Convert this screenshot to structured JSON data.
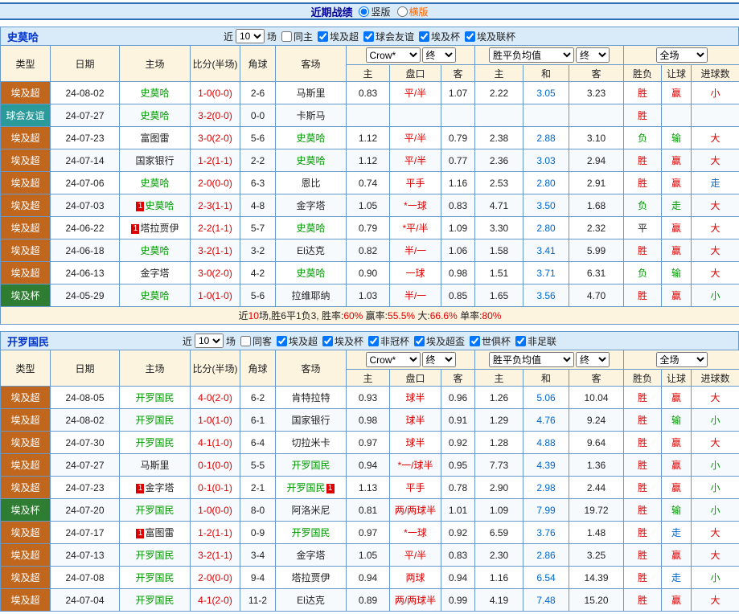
{
  "top_bar": {
    "title": "近期战绩",
    "radio_vertical": "竖版",
    "radio_horizontal": "横版",
    "vertical_selected": true
  },
  "colors": {
    "red": "#dd0000",
    "green": "#009900",
    "blue": "#0066cc",
    "black": "#222222",
    "team_green": "#009900",
    "type_league": "#c1671d",
    "type_friendly": "#2b9a9a",
    "type_cup": "#2e7d32",
    "bar_blue": "#d9eaf8",
    "header_cream": "#fdf4e0",
    "border_blue": "#6699cc",
    "title_blue": "#0000a0",
    "team_title_blue": "#0033cc",
    "orange_radio": "#ff6600"
  },
  "headers": {
    "type": "类型",
    "date": "日期",
    "home": "主场",
    "score": "比分(半场)",
    "corner": "角球",
    "away": "客场",
    "asian": [
      "主",
      "盘口",
      "客"
    ],
    "europe": [
      "主",
      "和",
      "客"
    ],
    "result": [
      "胜负",
      "让球",
      "进球数"
    ]
  },
  "selects": {
    "company": "Crow*",
    "company_time": "终",
    "europe": "胜平负均值",
    "europe_time": "终",
    "scope": "全场"
  },
  "sections": [
    {
      "team": "史莫哈",
      "filters": {
        "near": "近",
        "count": "10",
        "matches": "场",
        "checkboxes": [
          {
            "label": "同主",
            "checked": false
          },
          {
            "label": "埃及超",
            "checked": true
          },
          {
            "label": "球会友谊",
            "checked": true
          },
          {
            "label": "埃及杯",
            "checked": true
          },
          {
            "label": "埃及联杯",
            "checked": true
          }
        ]
      },
      "rows": [
        {
          "type": {
            "text": "埃及超",
            "kind": "league"
          },
          "date": "24-08-02",
          "home": {
            "name": "史莫哈",
            "green": true
          },
          "score": "1-0(0-0)",
          "corner": "2-6",
          "away": {
            "name": "马斯里"
          },
          "odds": [
            "0.83",
            "平/半",
            "1.07",
            "2.22",
            "3.05",
            "3.23"
          ],
          "results": [
            [
              "胜",
              "r"
            ],
            [
              "赢",
              "r"
            ],
            [
              "小",
              "r"
            ]
          ]
        },
        {
          "type": {
            "text": "球会友谊",
            "kind": "friendly"
          },
          "date": "24-07-27",
          "home": {
            "name": "史莫哈",
            "green": true
          },
          "score": "3-2(0-0)",
          "corner": "0-0",
          "away": {
            "name": "卡斯马"
          },
          "odds": [
            "",
            "",
            "",
            "",
            "",
            ""
          ],
          "results": [
            [
              "胜",
              "r"
            ],
            [
              "",
              ""
            ],
            [
              "",
              ""
            ]
          ]
        },
        {
          "type": {
            "text": "埃及超",
            "kind": "league"
          },
          "date": "24-07-23",
          "home": {
            "name": "富图雷"
          },
          "score": "3-0(2-0)",
          "corner": "5-6",
          "away": {
            "name": "史莫哈",
            "green": true
          },
          "odds": [
            "1.12",
            "平/半",
            "0.79",
            "2.38",
            "2.88",
            "3.10"
          ],
          "results": [
            [
              "负",
              "g"
            ],
            [
              "输",
              "g"
            ],
            [
              "大",
              "r"
            ]
          ]
        },
        {
          "type": {
            "text": "埃及超",
            "kind": "league"
          },
          "date": "24-07-14",
          "home": {
            "name": "国家银行"
          },
          "score": "1-2(1-1)",
          "corner": "2-2",
          "away": {
            "name": "史莫哈",
            "green": true
          },
          "odds": [
            "1.12",
            "平/半",
            "0.77",
            "2.36",
            "3.03",
            "2.94"
          ],
          "results": [
            [
              "胜",
              "r"
            ],
            [
              "赢",
              "r"
            ],
            [
              "大",
              "r"
            ]
          ]
        },
        {
          "type": {
            "text": "埃及超",
            "kind": "league"
          },
          "date": "24-07-06",
          "home": {
            "name": "史莫哈",
            "green": true
          },
          "score": "2-0(0-0)",
          "corner": "6-3",
          "away": {
            "name": "恩比"
          },
          "odds": [
            "0.74",
            "平手",
            "1.16",
            "2.53",
            "2.80",
            "2.91"
          ],
          "results": [
            [
              "胜",
              "r"
            ],
            [
              "赢",
              "r"
            ],
            [
              "走",
              "b"
            ]
          ]
        },
        {
          "type": {
            "text": "埃及超",
            "kind": "league"
          },
          "date": "24-07-03",
          "home": {
            "name": "史莫哈",
            "green": true,
            "badge": "1",
            "badgePos": "before"
          },
          "score": "2-3(1-1)",
          "corner": "4-8",
          "away": {
            "name": "金字塔"
          },
          "odds": [
            "1.05",
            "*一球",
            "0.83",
            "4.71",
            "3.50",
            "1.68"
          ],
          "results": [
            [
              "负",
              "g"
            ],
            [
              "走",
              "g"
            ],
            [
              "大",
              "r"
            ]
          ]
        },
        {
          "type": {
            "text": "埃及超",
            "kind": "league"
          },
          "date": "24-06-22",
          "home": {
            "name": "塔拉贾伊",
            "badge": "1",
            "badgePos": "before"
          },
          "score": "2-2(1-1)",
          "corner": "5-7",
          "away": {
            "name": "史莫哈",
            "green": true
          },
          "odds": [
            "0.79",
            "*平/半",
            "1.09",
            "3.30",
            "2.80",
            "2.32"
          ],
          "results": [
            [
              "平",
              "k"
            ],
            [
              "赢",
              "r"
            ],
            [
              "大",
              "r"
            ]
          ]
        },
        {
          "type": {
            "text": "埃及超",
            "kind": "league"
          },
          "date": "24-06-18",
          "home": {
            "name": "史莫哈",
            "green": true
          },
          "score": "3-2(1-1)",
          "corner": "3-2",
          "away": {
            "name": "El达克"
          },
          "odds": [
            "0.82",
            "半/一",
            "1.06",
            "1.58",
            "3.41",
            "5.99"
          ],
          "results": [
            [
              "胜",
              "r"
            ],
            [
              "赢",
              "r"
            ],
            [
              "大",
              "r"
            ]
          ]
        },
        {
          "type": {
            "text": "埃及超",
            "kind": "league"
          },
          "date": "24-06-13",
          "home": {
            "name": "金字塔"
          },
          "score": "3-0(2-0)",
          "corner": "4-2",
          "away": {
            "name": "史莫哈",
            "green": true
          },
          "odds": [
            "0.90",
            "一球",
            "0.98",
            "1.51",
            "3.71",
            "6.31"
          ],
          "results": [
            [
              "负",
              "g"
            ],
            [
              "输",
              "g"
            ],
            [
              "大",
              "r"
            ]
          ]
        },
        {
          "type": {
            "text": "埃及杯",
            "kind": "cup"
          },
          "date": "24-05-29",
          "home": {
            "name": "史莫哈",
            "green": true
          },
          "score": "1-0(1-0)",
          "corner": "5-6",
          "away": {
            "name": "拉维耶纳"
          },
          "odds": [
            "1.03",
            "半/一",
            "0.85",
            "1.65",
            "3.56",
            "4.70"
          ],
          "results": [
            [
              "胜",
              "r"
            ],
            [
              "赢",
              "r"
            ],
            [
              "小",
              "g"
            ]
          ]
        }
      ],
      "summary": [
        [
          "近",
          "k"
        ],
        [
          "10",
          "r"
        ],
        [
          "场,胜6平1负3, 胜率:",
          "k"
        ],
        [
          "60%",
          "r"
        ],
        [
          " 赢率:",
          "k"
        ],
        [
          "55.5%",
          "r"
        ],
        [
          " 大:",
          "k"
        ],
        [
          "66.6%",
          "r"
        ],
        [
          " 单率:",
          "k"
        ],
        [
          "80%",
          "r"
        ]
      ]
    },
    {
      "team": "开罗国民",
      "filters": {
        "near": "近",
        "count": "10",
        "matches": "场",
        "checkboxes": [
          {
            "label": "同客",
            "checked": false
          },
          {
            "label": "埃及超",
            "checked": true
          },
          {
            "label": "埃及杯",
            "checked": true
          },
          {
            "label": "非冠杯",
            "checked": true
          },
          {
            "label": "埃及超盃",
            "checked": true
          },
          {
            "label": "世俱杯",
            "checked": true
          },
          {
            "label": "非足联",
            "checked": true
          }
        ]
      },
      "rows": [
        {
          "type": {
            "text": "埃及超",
            "kind": "league"
          },
          "date": "24-08-05",
          "home": {
            "name": "开罗国民",
            "green": true
          },
          "score": "4-0(2-0)",
          "corner": "6-2",
          "away": {
            "name": "肯特拉特"
          },
          "odds": [
            "0.93",
            "球半",
            "0.96",
            "1.26",
            "5.06",
            "10.04"
          ],
          "results": [
            [
              "胜",
              "r"
            ],
            [
              "赢",
              "r"
            ],
            [
              "大",
              "r"
            ]
          ]
        },
        {
          "type": {
            "text": "埃及超",
            "kind": "league"
          },
          "date": "24-08-02",
          "home": {
            "name": "开罗国民",
            "green": true
          },
          "score": "1-0(1-0)",
          "corner": "6-1",
          "away": {
            "name": "国家银行"
          },
          "odds": [
            "0.98",
            "球半",
            "0.91",
            "1.29",
            "4.76",
            "9.24"
          ],
          "results": [
            [
              "胜",
              "r"
            ],
            [
              "输",
              "g"
            ],
            [
              "小",
              "g"
            ]
          ]
        },
        {
          "type": {
            "text": "埃及超",
            "kind": "league"
          },
          "date": "24-07-30",
          "home": {
            "name": "开罗国民",
            "green": true
          },
          "score": "4-1(1-0)",
          "corner": "6-4",
          "away": {
            "name": "切拉米卡"
          },
          "odds": [
            "0.97",
            "球半",
            "0.92",
            "1.28",
            "4.88",
            "9.64"
          ],
          "results": [
            [
              "胜",
              "r"
            ],
            [
              "赢",
              "r"
            ],
            [
              "大",
              "r"
            ]
          ]
        },
        {
          "type": {
            "text": "埃及超",
            "kind": "league"
          },
          "date": "24-07-27",
          "home": {
            "name": "马斯里"
          },
          "score": "0-1(0-0)",
          "corner": "5-5",
          "away": {
            "name": "开罗国民",
            "green": true
          },
          "odds": [
            "0.94",
            "*一/球半",
            "0.95",
            "7.73",
            "4.39",
            "1.36"
          ],
          "results": [
            [
              "胜",
              "r"
            ],
            [
              "赢",
              "r"
            ],
            [
              "小",
              "g"
            ]
          ]
        },
        {
          "type": {
            "text": "埃及超",
            "kind": "league"
          },
          "date": "24-07-23",
          "home": {
            "name": "金字塔",
            "badge": "1",
            "badgePos": "before"
          },
          "score": "0-1(0-1)",
          "corner": "2-1",
          "away": {
            "name": "开罗国民",
            "green": true,
            "badge": "1",
            "badgePos": "after"
          },
          "odds": [
            "1.13",
            "平手",
            "0.78",
            "2.90",
            "2.98",
            "2.44"
          ],
          "results": [
            [
              "胜",
              "r"
            ],
            [
              "赢",
              "r"
            ],
            [
              "小",
              "g"
            ]
          ]
        },
        {
          "type": {
            "text": "埃及杯",
            "kind": "cup"
          },
          "date": "24-07-20",
          "home": {
            "name": "开罗国民",
            "green": true
          },
          "score": "1-0(0-0)",
          "corner": "8-0",
          "away": {
            "name": "阿洛米尼"
          },
          "odds": [
            "0.81",
            "两/两球半",
            "1.01",
            "1.09",
            "7.99",
            "19.72"
          ],
          "results": [
            [
              "胜",
              "r"
            ],
            [
              "输",
              "g"
            ],
            [
              "小",
              "g"
            ]
          ]
        },
        {
          "type": {
            "text": "埃及超",
            "kind": "league"
          },
          "date": "24-07-17",
          "home": {
            "name": "富图雷",
            "badge": "1",
            "badgePos": "before"
          },
          "score": "1-2(1-1)",
          "corner": "0-9",
          "away": {
            "name": "开罗国民",
            "green": true
          },
          "odds": [
            "0.97",
            "*一球",
            "0.92",
            "6.59",
            "3.76",
            "1.48"
          ],
          "results": [
            [
              "胜",
              "r"
            ],
            [
              "走",
              "b"
            ],
            [
              "大",
              "r"
            ]
          ]
        },
        {
          "type": {
            "text": "埃及超",
            "kind": "league"
          },
          "date": "24-07-13",
          "home": {
            "name": "开罗国民",
            "green": true
          },
          "score": "3-2(1-1)",
          "corner": "3-4",
          "away": {
            "name": "金字塔"
          },
          "odds": [
            "1.05",
            "平/半",
            "0.83",
            "2.30",
            "2.86",
            "3.25"
          ],
          "results": [
            [
              "胜",
              "r"
            ],
            [
              "赢",
              "r"
            ],
            [
              "大",
              "r"
            ]
          ]
        },
        {
          "type": {
            "text": "埃及超",
            "kind": "league"
          },
          "date": "24-07-08",
          "home": {
            "name": "开罗国民",
            "green": true
          },
          "score": "2-0(0-0)",
          "corner": "9-4",
          "away": {
            "name": "塔拉贾伊"
          },
          "odds": [
            "0.94",
            "两球",
            "0.94",
            "1.16",
            "6.54",
            "14.39"
          ],
          "results": [
            [
              "胜",
              "r"
            ],
            [
              "走",
              "b"
            ],
            [
              "小",
              "g"
            ]
          ]
        },
        {
          "type": {
            "text": "埃及超",
            "kind": "league"
          },
          "date": "24-07-04",
          "home": {
            "name": "开罗国民",
            "green": true
          },
          "score": "4-1(2-0)",
          "corner": "11-2",
          "away": {
            "name": "El达克"
          },
          "odds": [
            "0.89",
            "两/两球半",
            "0.99",
            "4.19",
            "7.48",
            "15.20"
          ],
          "results": [
            [
              "胜",
              "r"
            ],
            [
              "赢",
              "r"
            ],
            [
              "大",
              "r"
            ]
          ]
        }
      ]
    }
  ]
}
